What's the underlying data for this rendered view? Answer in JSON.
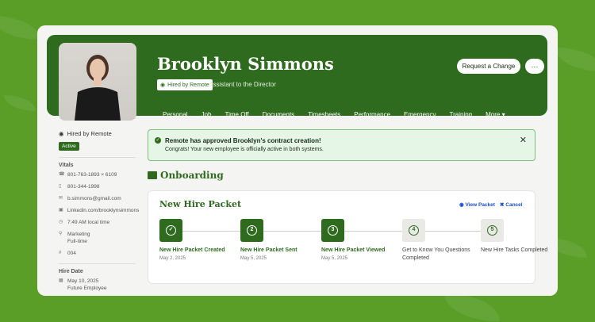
{
  "profile": {
    "name": "Brooklyn Simmons",
    "hired_badge": "Hired by Remote",
    "job_title": "Assistant to the Director"
  },
  "header_actions": {
    "request_change": "Request a Change",
    "more": "···"
  },
  "tabs": [
    {
      "label": "Personal"
    },
    {
      "label": "Job"
    },
    {
      "label": "Time Off"
    },
    {
      "label": "Documents"
    },
    {
      "label": "Timesheets"
    },
    {
      "label": "Performance"
    },
    {
      "label": "Emergency"
    },
    {
      "label": "Training"
    },
    {
      "label": "More ▾"
    }
  ],
  "sidebar": {
    "hired_by": "Hired by Remote",
    "status": "Active",
    "vitals_heading": "Vitals",
    "vitals": [
      {
        "icon": "phone-icon",
        "text": "801-763-1893 × 6109"
      },
      {
        "icon": "mobile-icon",
        "text": "801-344-1998"
      },
      {
        "icon": "email-icon",
        "text": "b.simmons@gmail.com"
      },
      {
        "icon": "linkedin-icon",
        "text": "Linkedin.com/brooklynsimmons"
      },
      {
        "icon": "clock-icon",
        "text": "7:49 AM local time"
      },
      {
        "icon": "tag-icon",
        "text": "Marketing",
        "sub": "Full-time"
      },
      {
        "icon": "hash-icon",
        "text": "004"
      }
    ],
    "hire_date_heading": "Hire Date",
    "hire_date": "May 10, 2025",
    "hire_note": "Future Employee"
  },
  "alert": {
    "title": "Remote has approved Brooklyn's contract creation!",
    "text": "Congrats! Your new employee is officially active in both systems."
  },
  "onboarding": {
    "title": "Onboarding",
    "packet_title": "New Hire Packet",
    "view_packet": "View Packet",
    "cancel": "Cancel",
    "steps": [
      {
        "num": "✓",
        "label": "New Hire Packet Created",
        "date": "May 2, 2025",
        "done": true
      },
      {
        "num": "2",
        "label": "New Hire Packet Sent",
        "date": "May 5, 2025",
        "done": true
      },
      {
        "num": "3",
        "label": "New Hire Packet Viewed",
        "date": "May 5, 2025",
        "done": true
      },
      {
        "num": "4",
        "label": "Get to Know You Questions Completed",
        "date": "",
        "done": false
      },
      {
        "num": "5",
        "label": "New Hire Tasks Completed",
        "date": "",
        "done": false
      }
    ]
  },
  "colors": {
    "brand_green": "#2e6b1f",
    "background_green": "#5a9e28",
    "link_blue": "#1a4fcc"
  }
}
